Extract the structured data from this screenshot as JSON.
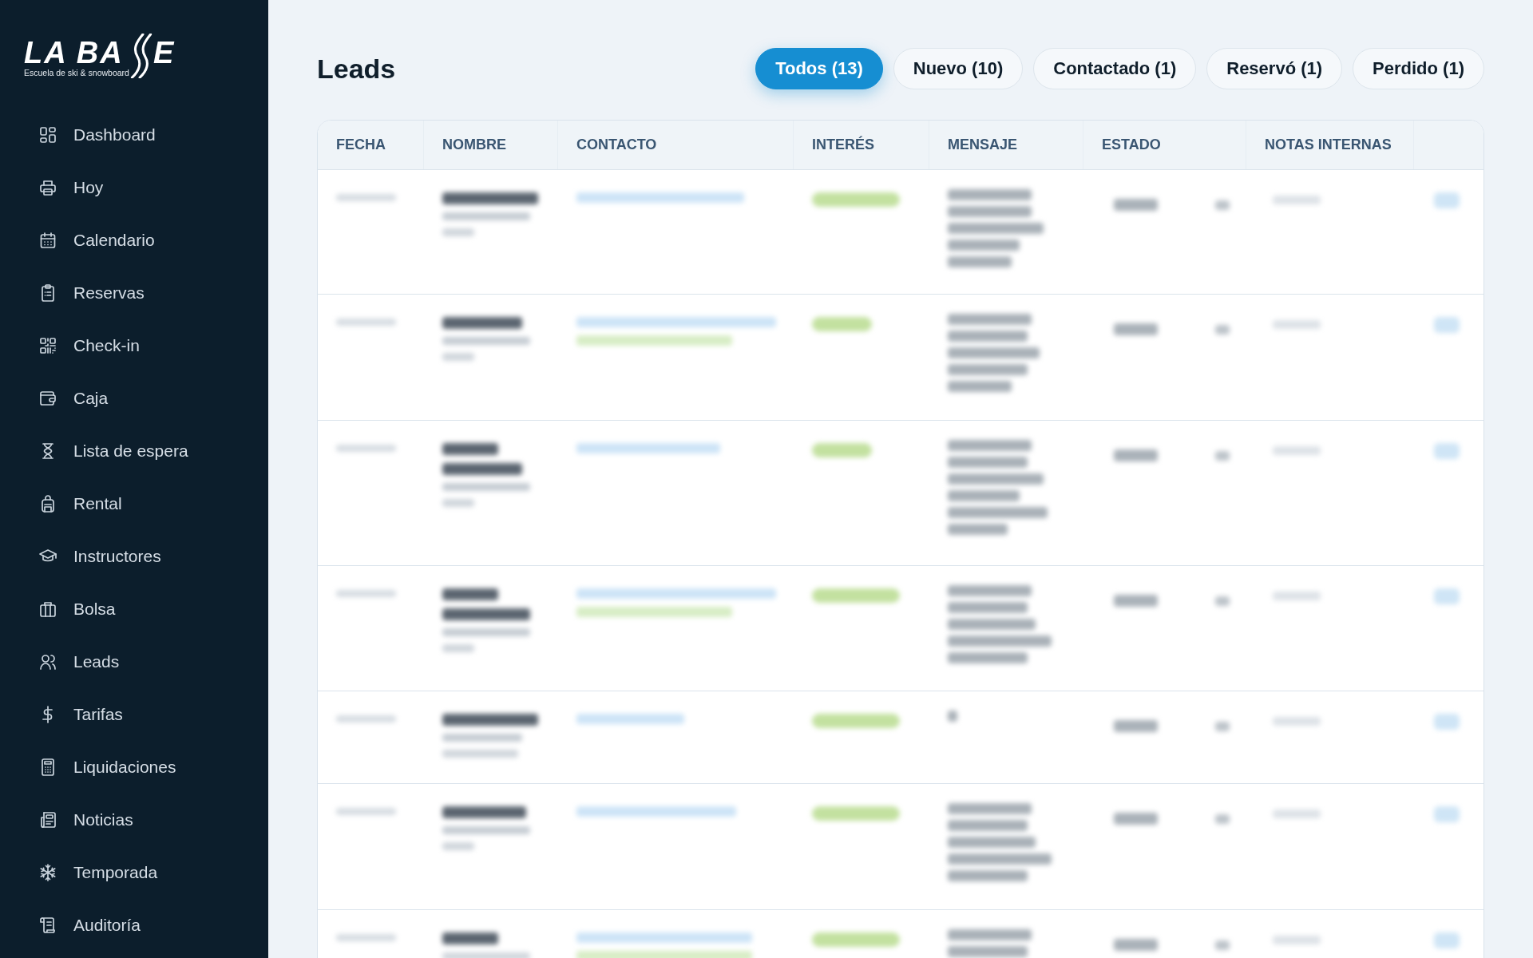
{
  "logo": {
    "wordmark_start": "LA BA",
    "wordmark_end": "E",
    "tagline": "Escuela de ski & snowboard"
  },
  "sidebar": {
    "items": [
      {
        "label": "Dashboard"
      },
      {
        "label": "Hoy"
      },
      {
        "label": "Calendario"
      },
      {
        "label": "Reservas"
      },
      {
        "label": "Check-in"
      },
      {
        "label": "Caja"
      },
      {
        "label": "Lista de espera"
      },
      {
        "label": "Rental"
      },
      {
        "label": "Instructores"
      },
      {
        "label": "Bolsa"
      },
      {
        "label": "Leads"
      },
      {
        "label": "Tarifas"
      },
      {
        "label": "Liquidaciones"
      },
      {
        "label": "Noticias"
      },
      {
        "label": "Temporada"
      },
      {
        "label": "Auditoría"
      }
    ]
  },
  "page": {
    "title": "Leads"
  },
  "filters": [
    {
      "label": "Todos (13)",
      "selected": true
    },
    {
      "label": "Nuevo (10)",
      "selected": false
    },
    {
      "label": "Contactado (1)",
      "selected": false
    },
    {
      "label": "Reservó (1)",
      "selected": false
    },
    {
      "label": "Perdido (1)",
      "selected": false
    }
  ],
  "table": {
    "columns": [
      "FECHA",
      "NOMBRE",
      "CONTACTO",
      "INTERÉS",
      "MENSAJE",
      "ESTADO",
      "NOTAS INTERNAS"
    ]
  }
}
